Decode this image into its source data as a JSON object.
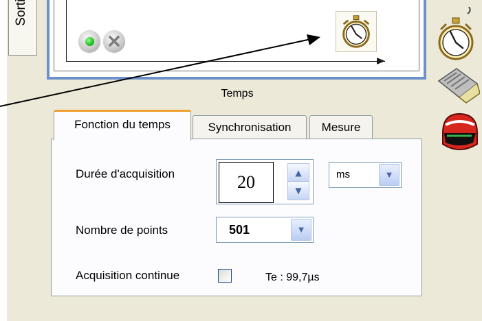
{
  "side_panel": {
    "tab_label": "Sortie"
  },
  "graph": {
    "caption": "Temps"
  },
  "tabs": [
    {
      "label": "Fonction du temps",
      "active": true
    },
    {
      "label": "Synchronisation",
      "active": false
    },
    {
      "label": "Mesure",
      "active": false
    }
  ],
  "form": {
    "duration": {
      "label": "Durée d'acquisition",
      "value": "20",
      "unit": "ms"
    },
    "points": {
      "label": "Nombre de points",
      "value": "501"
    },
    "continuous": {
      "label": "Acquisition continue",
      "checked": false,
      "sampling": "Te : 99,7µs"
    }
  },
  "icons": {
    "canvas_buttons": [
      "start-icon",
      "stop-icon",
      "stopwatch-icon"
    ],
    "toolbar": [
      "stopwatch-icon",
      "keyboard-icon",
      "helmet-icon"
    ]
  },
  "colors": {
    "active_tab_accent": "#f0a030",
    "canvas_border": "#6d8fca",
    "spin_accent": "#4a64a6"
  }
}
